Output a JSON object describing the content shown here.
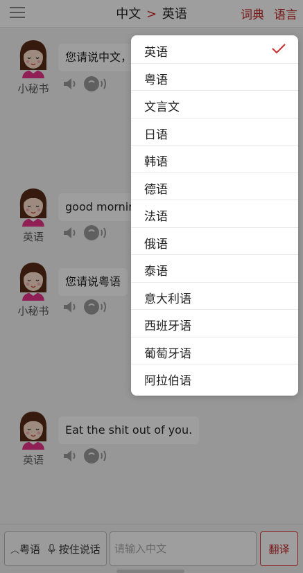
{
  "header": {
    "title_from": "中文",
    "title_arrow": ">",
    "title_to": "英语",
    "dictionary_label": "词典",
    "language_label": "语言"
  },
  "messages": [
    {
      "sender": "小秘书",
      "text": "您请说中文，"
    },
    {
      "sender": "英语",
      "text": "good mornir"
    },
    {
      "sender": "小秘书",
      "text": "您请说粤语"
    },
    {
      "sender": "英语",
      "text": "Eat the shit out of you."
    }
  ],
  "language_menu": {
    "items": [
      {
        "label": "英语",
        "selected": true
      },
      {
        "label": "粤语",
        "selected": false
      },
      {
        "label": "文言文",
        "selected": false
      },
      {
        "label": "日语",
        "selected": false
      },
      {
        "label": "韩语",
        "selected": false
      },
      {
        "label": "德语",
        "selected": false
      },
      {
        "label": "法语",
        "selected": false
      },
      {
        "label": "俄语",
        "selected": false
      },
      {
        "label": "泰语",
        "selected": false
      },
      {
        "label": "意大利语",
        "selected": false
      },
      {
        "label": "西班牙语",
        "selected": false
      },
      {
        "label": "葡萄牙语",
        "selected": false
      },
      {
        "label": "阿拉伯语",
        "selected": false
      }
    ]
  },
  "bottom_bar": {
    "lang_select_label": "粤语",
    "press_to_talk_label": "按住说话",
    "input_placeholder": "请输入中文",
    "input_value": "",
    "translate_label": "翻译"
  },
  "colors": {
    "accent": "#c22525",
    "overlay": "#000000",
    "bubble": "#ffffff"
  }
}
